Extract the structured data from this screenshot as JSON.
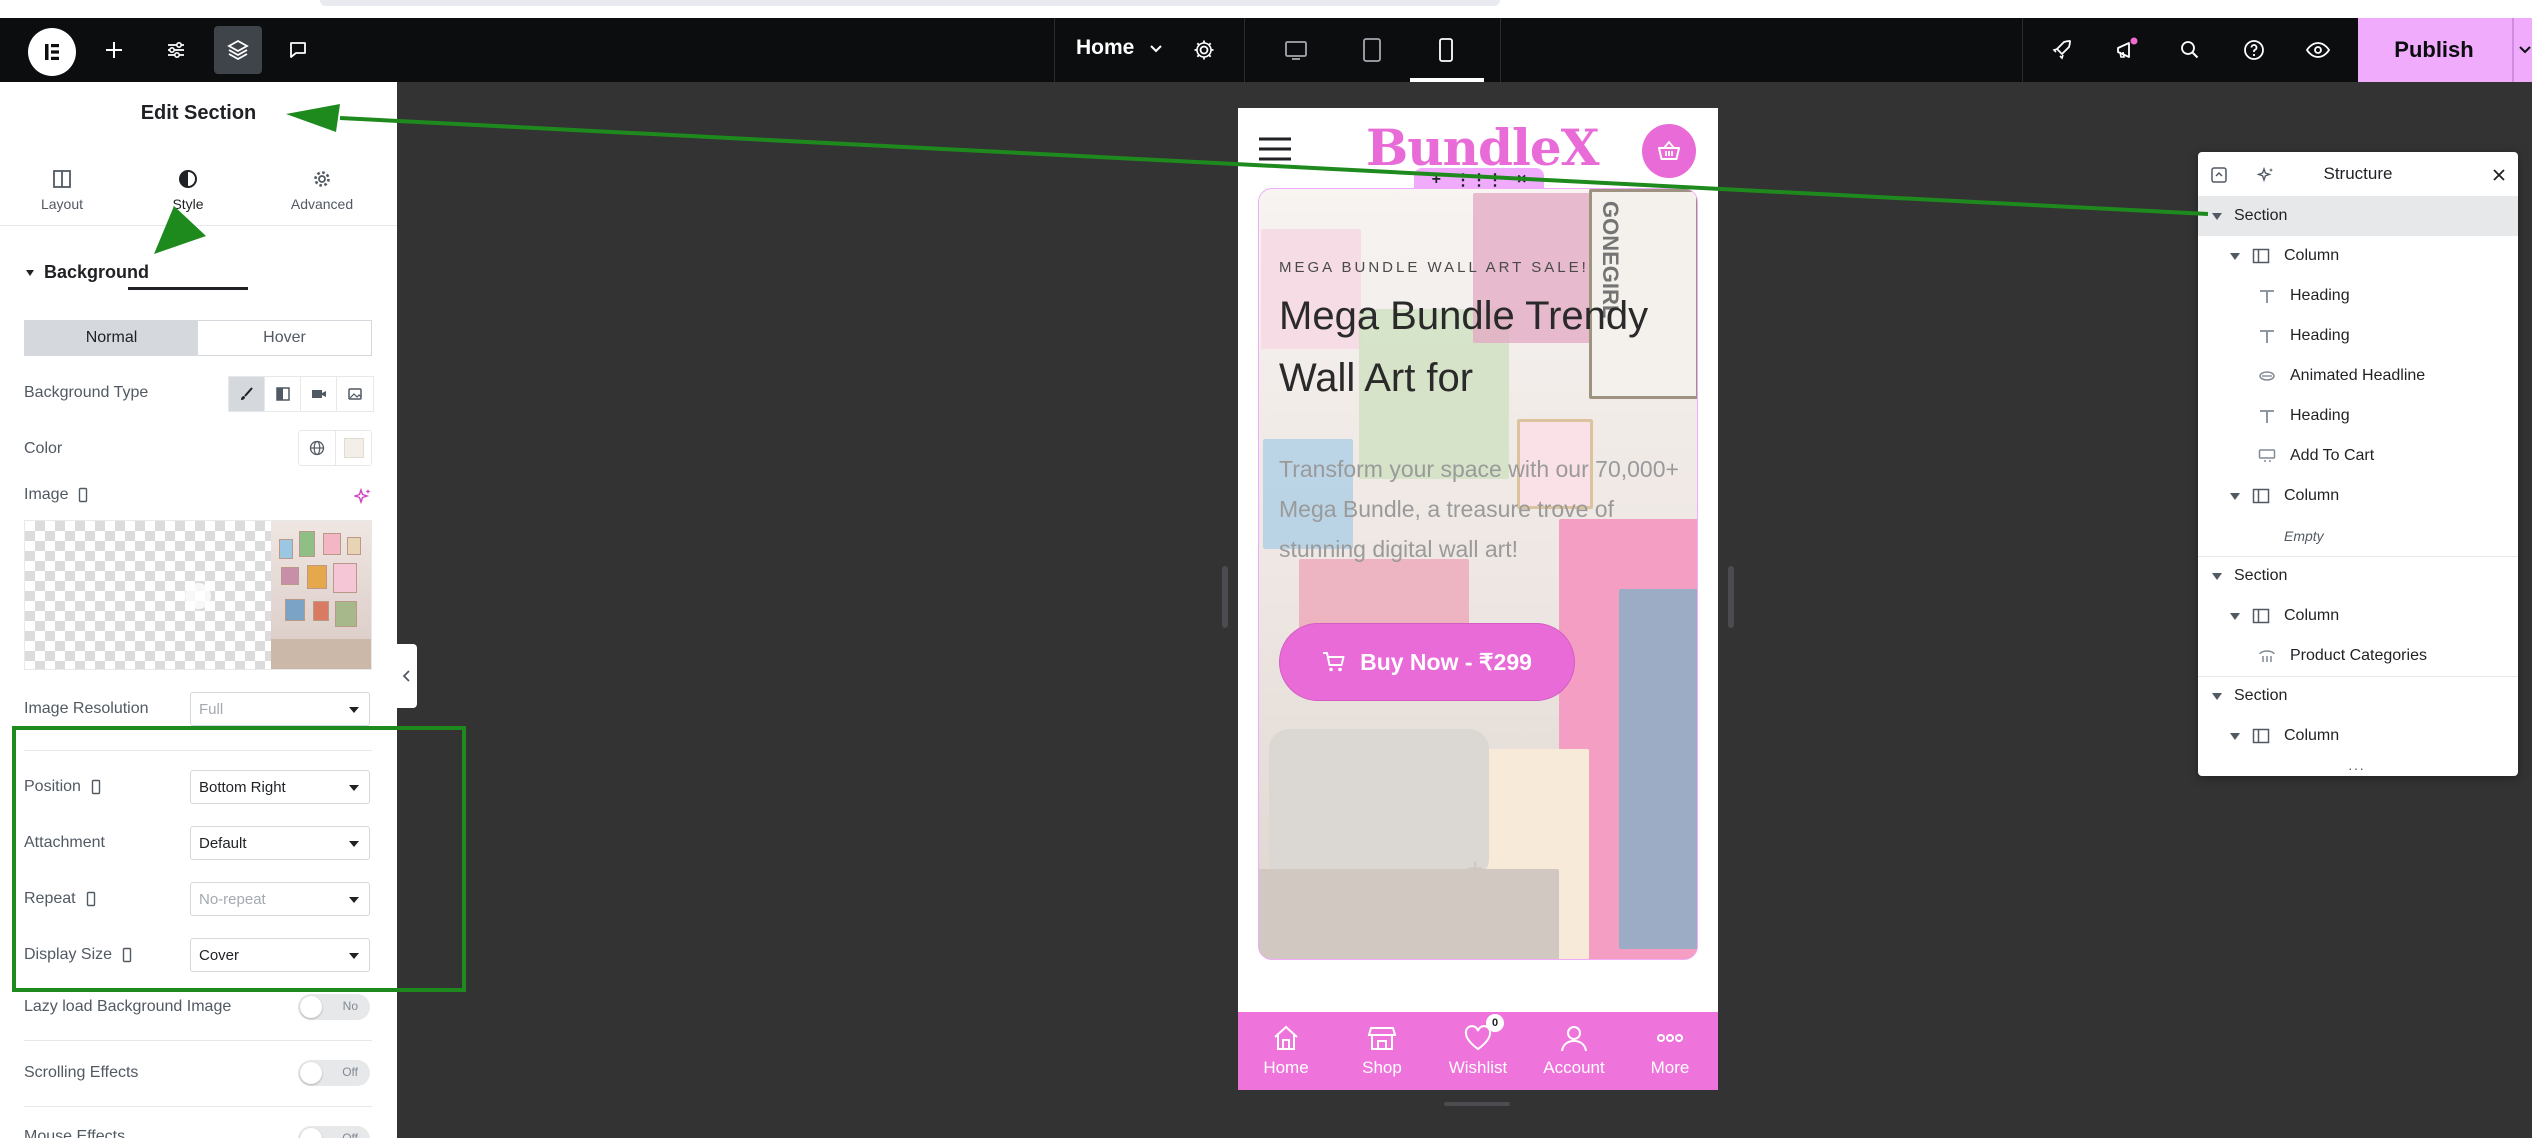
{
  "topbar": {
    "page_name": "Home",
    "publish_label": "Publish"
  },
  "panel": {
    "title": "Edit Section",
    "tabs": [
      {
        "label": "Layout",
        "icon": "layout-icon"
      },
      {
        "label": "Style",
        "icon": "half-circle-icon",
        "active": true
      },
      {
        "label": "Advanced",
        "icon": "gear-icon"
      }
    ],
    "section_title": "Background",
    "state_tabs": [
      "Normal",
      "Hover"
    ],
    "background_type_label": "Background Type",
    "color_label": "Color",
    "image_label": "Image",
    "image_resolution": {
      "label": "Image Resolution",
      "value": "Full"
    },
    "position": {
      "label": "Position",
      "value": "Bottom Right"
    },
    "attachment": {
      "label": "Attachment",
      "value": "Default"
    },
    "repeat": {
      "label": "Repeat",
      "value": "No-repeat"
    },
    "display_size": {
      "label": "Display Size",
      "value": "Cover"
    },
    "lazy_load": {
      "label": "Lazy load Background Image",
      "state": "No"
    },
    "scrolling_effects": {
      "label": "Scrolling Effects",
      "state": "Off"
    },
    "mouse_effects": {
      "label": "Mouse Effects",
      "state": "Off"
    }
  },
  "preview": {
    "site_logo": "BundleX",
    "hero": {
      "kicker": "MEGA BUNDLE WALL ART SALE!",
      "title": "Mega Bundle Trendy Wall Art for",
      "description": "Transform your space with our 70,000+ Mega Bundle, a treasure trove of stunning digital wall art!",
      "button": "Buy Now - ₹299"
    },
    "poster_text": "GONEGIRL",
    "nav": [
      {
        "label": "Home",
        "icon": "home-icon"
      },
      {
        "label": "Shop",
        "icon": "shop-icon"
      },
      {
        "label": "Wishlist",
        "icon": "heart-icon",
        "badge": "0"
      },
      {
        "label": "Account",
        "icon": "user-icon"
      },
      {
        "label": "More",
        "icon": "more-icon"
      }
    ]
  },
  "structure": {
    "title": "Structure",
    "rows": [
      {
        "label": "Section",
        "level": 0,
        "type": "section",
        "selected": true
      },
      {
        "label": "Column",
        "level": 1,
        "type": "column"
      },
      {
        "label": "Heading",
        "level": 2,
        "type": "heading"
      },
      {
        "label": "Heading",
        "level": 2,
        "type": "heading"
      },
      {
        "label": "Animated Headline",
        "level": 2,
        "type": "animated"
      },
      {
        "label": "Heading",
        "level": 2,
        "type": "heading"
      },
      {
        "label": "Add To Cart",
        "level": 2,
        "type": "cart"
      },
      {
        "label": "Column",
        "level": 1,
        "type": "column"
      },
      {
        "label": "Empty",
        "level": 2,
        "type": "empty"
      },
      {
        "label": "Section",
        "level": 0,
        "type": "section"
      },
      {
        "label": "Column",
        "level": 1,
        "type": "column"
      },
      {
        "label": "Product Categories",
        "level": 2,
        "type": "categories"
      },
      {
        "label": "Section",
        "level": 0,
        "type": "section"
      },
      {
        "label": "Column",
        "level": 1,
        "type": "column"
      }
    ]
  },
  "colors": {
    "accent_pink": "#e86bd7",
    "publish_bg": "#f0abfc",
    "annotation_green": "#1e8a1e"
  }
}
